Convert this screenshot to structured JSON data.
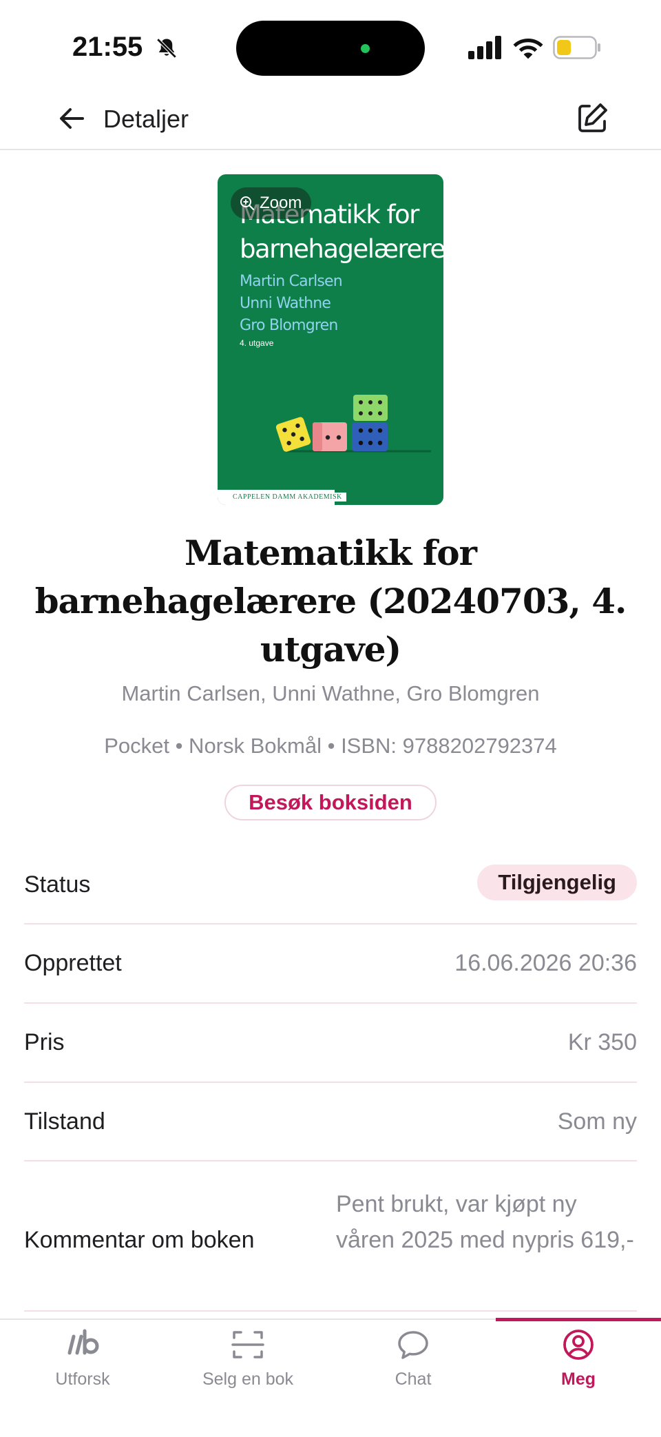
{
  "status_bar": {
    "time": "21:55",
    "icons": [
      "bell-slash-icon",
      "signal-icon",
      "wifi-icon",
      "battery-low-icon"
    ]
  },
  "header": {
    "title": "Detaljer",
    "back_icon": "arrow-left-icon",
    "edit_icon": "edit-icon"
  },
  "cover": {
    "title": "Matematikk for barnehagelærere",
    "authors": [
      "Martin Carlsen",
      "Unni Wathne",
      "Gro Blomgren"
    ],
    "edition": "4. utgave",
    "publisher": "CAPPELEN DAMM AKADEMISK",
    "zoom_label": "Zoom",
    "zoom_icon": "zoom-in-icon",
    "background_color": "#0f7f49"
  },
  "book": {
    "title": "Matematikk for barnehagelærere (20240703, 4. utgave)",
    "authors": "Martin Carlsen, Unni Wathne, Gro Blomgren",
    "meta": "Pocket • Norsk Bokmål • ISBN: 9788202792374",
    "visit_button": "Besøk boksiden"
  },
  "details": {
    "status": {
      "label": "Status",
      "value": "Tilgjengelig"
    },
    "created": {
      "label": "Opprettet",
      "value": "16.06.2026 20:36"
    },
    "price": {
      "label": "Pris",
      "value": "Kr 350"
    },
    "condition": {
      "label": "Tilstand",
      "value": "Som ny"
    },
    "comment": {
      "label": "Kommentar om boken",
      "value": "Pent brukt, var kjøpt ny våren 2025 med nypris 619,-"
    }
  },
  "tabbar": {
    "tabs": [
      {
        "label": "Utforsk",
        "icon": "explore-logo-icon",
        "active": false
      },
      {
        "label": "Selg en bok",
        "icon": "scan-icon",
        "active": false
      },
      {
        "label": "Chat",
        "icon": "chat-bubble-icon",
        "active": false
      },
      {
        "label": "Meg",
        "icon": "user-circle-icon",
        "active": true
      }
    ]
  },
  "colors": {
    "accent": "#c2185b",
    "badge_bg": "#fbe3ea",
    "muted_text": "#8a8a92"
  }
}
